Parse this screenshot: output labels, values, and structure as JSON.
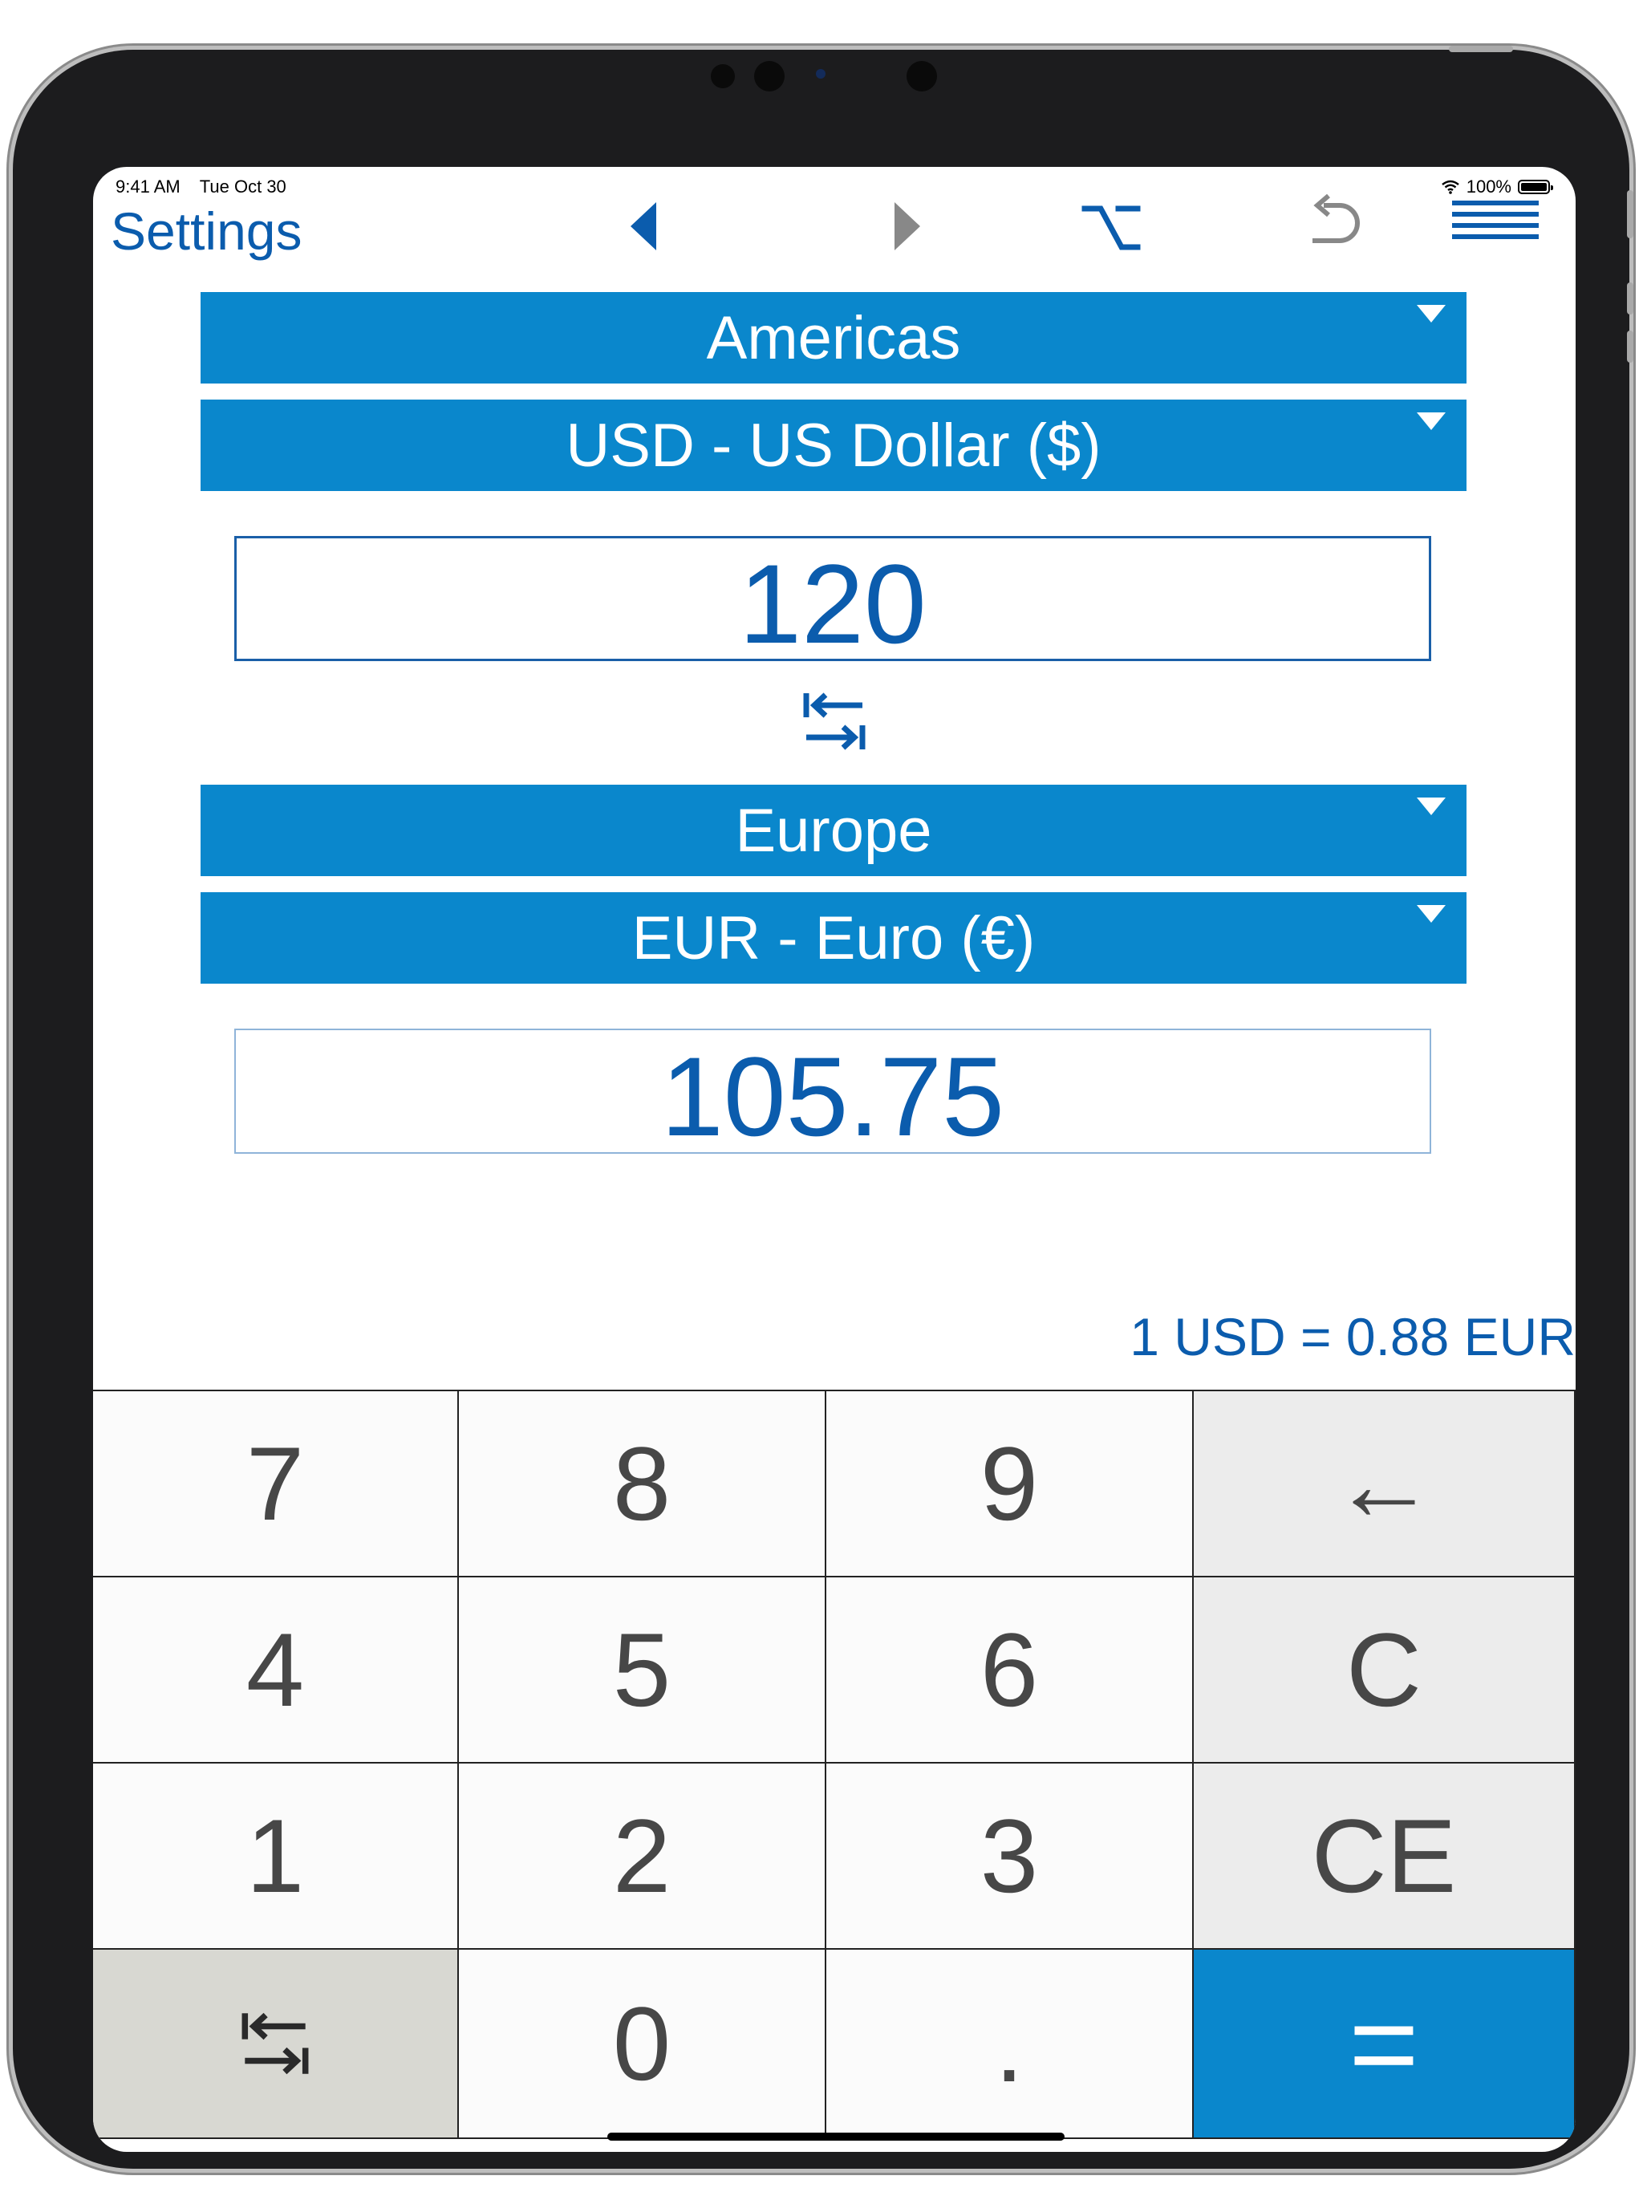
{
  "status_bar": {
    "time": "9:41 AM",
    "date": "Tue Oct 30",
    "battery": "100%"
  },
  "nav": {
    "settings_label": "Settings",
    "icons": [
      "back-arrow-icon",
      "forward-arrow-icon",
      "option-key-icon",
      "undo-icon",
      "menu-icon"
    ]
  },
  "from": {
    "region": "Americas",
    "currency": "USD - US Dollar ($)",
    "amount": "120"
  },
  "to": {
    "region": "Europe",
    "currency": "EUR - Euro (€)",
    "amount": "105.75"
  },
  "rate_text": "1 USD = 0.88 EUR",
  "keypad": {
    "k7": "7",
    "k8": "8",
    "k9": "9",
    "backspace": "←",
    "k4": "4",
    "k5": "5",
    "k6": "6",
    "clear": "C",
    "k1": "1",
    "k2": "2",
    "k3": "3",
    "clear_entry": "CE",
    "k0": "0",
    "decimal": ".",
    "equals": "="
  },
  "colors": {
    "accent": "#0a87cc",
    "text_blue": "#0b5cad",
    "key_text": "#474747"
  }
}
